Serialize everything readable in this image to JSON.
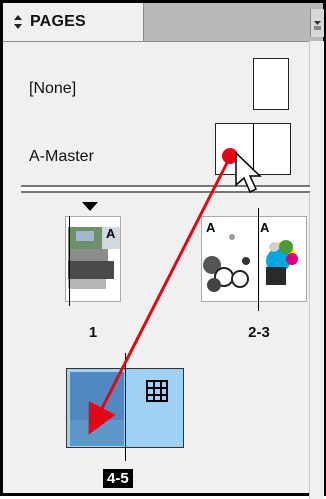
{
  "panel": {
    "tab_title": "PAGES",
    "tab_icon": "expand-collapse-arrows-icon",
    "menu_icon": "panel-menu-icon"
  },
  "masters": [
    {
      "label": "[None]"
    },
    {
      "label": "A-Master"
    }
  ],
  "pages": {
    "master_prefix": "A",
    "spreads": [
      {
        "label": "1",
        "selected": false
      },
      {
        "label": "2-3",
        "selected": false
      },
      {
        "label": "4-5",
        "selected": true
      }
    ]
  },
  "annotation": {
    "arrow_color": "#e30613",
    "cursor_icon": "mouse-pointer-icon"
  }
}
